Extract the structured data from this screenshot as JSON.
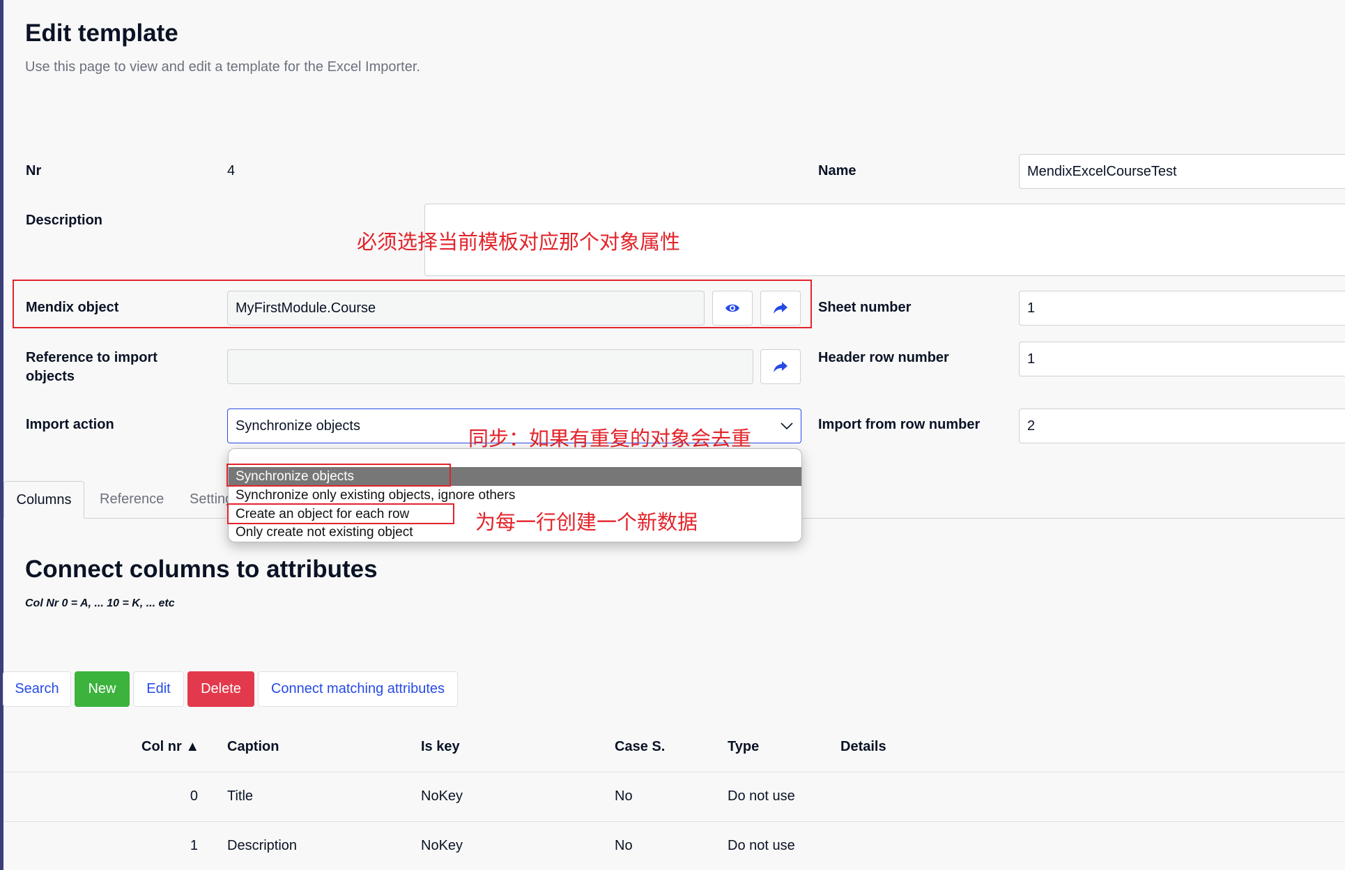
{
  "header": {
    "title": "Edit template",
    "subtitle": "Use this page to view and edit a template for the Excel Importer."
  },
  "form": {
    "nr_label": "Nr",
    "nr_value": "4",
    "name_label": "Name",
    "name_value": "MendixExcelCourseTest",
    "description_label": "Description",
    "description_value": "",
    "mendix_object_label": "Mendix object",
    "mendix_object_value": "MyFirstModule.Course",
    "reference_label": "Reference to import objects",
    "reference_value": "",
    "import_action_label": "Import action",
    "import_action_value": "Synchronize objects",
    "sheet_number_label": "Sheet number",
    "sheet_number_value": "1",
    "header_row_label": "Header row number",
    "header_row_value": "1",
    "import_from_row_label": "Import from row number",
    "import_from_row_value": "2"
  },
  "dropdown": {
    "options": [
      "",
      "Synchronize objects",
      "Synchronize only existing objects, ignore others",
      "Create an object for each row",
      "Only create not existing object"
    ]
  },
  "annotations": {
    "mendix_object_note": "必须选择当前模板对应那个对象属性",
    "sync_note": "同步：如果有重复的对象会去重",
    "create_note": "为每一行创建一个新数据"
  },
  "tabs": [
    "Columns",
    "Reference",
    "Settings"
  ],
  "section": {
    "title": "Connect columns to attributes",
    "note": "Col Nr 0 = A, ... 10 = K, ... etc"
  },
  "toolbar": {
    "search": "Search",
    "new": "New",
    "edit": "Edit",
    "delete": "Delete",
    "connect": "Connect matching attributes"
  },
  "table": {
    "headers": [
      "Col nr ▲",
      "Caption",
      "Is key",
      "Case S.",
      "Type",
      "Details"
    ],
    "rows": [
      [
        "0",
        "Title",
        "NoKey",
        "No",
        "Do not use",
        ""
      ],
      [
        "1",
        "Description",
        "NoKey",
        "No",
        "Do not use",
        ""
      ]
    ]
  },
  "colors": {
    "accent": "#264ae5",
    "annotation": "#e2232a",
    "new_button": "#3cb33d",
    "delete_button": "#e3394c"
  }
}
